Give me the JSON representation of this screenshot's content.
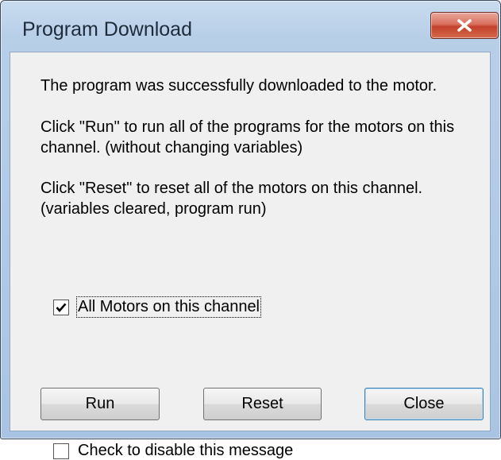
{
  "window": {
    "title": "Program Download",
    "close_glyph": "x"
  },
  "messages": [
    "The program was successfully downloaded to the motor.",
    "Click \"Run\" to run all of the programs for the motors on this",
    "channel. (without changing variables)",
    "Click \"Reset\" to reset all of the motors on this channel.",
    "(variables cleared, program run)"
  ],
  "all_motors_checkbox": {
    "label": "All Motors on this channel",
    "checked": true
  },
  "buttons": {
    "run": "Run",
    "reset": "Reset",
    "close": "Close"
  },
  "disable_message_checkbox": {
    "label": "Check to disable this message",
    "checked": false
  },
  "colors": {
    "title_close_red": "#c3412c",
    "dialog_face": "#f0f0f0",
    "frame_blue": "#a9c4e2"
  }
}
